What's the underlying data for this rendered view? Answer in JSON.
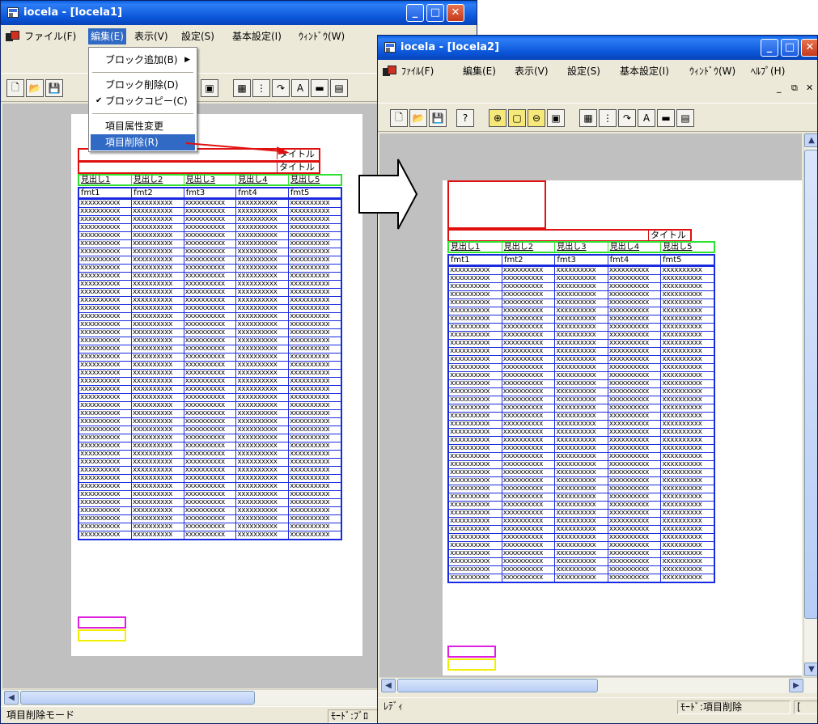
{
  "window1": {
    "title": "iocela - [Iocela1]",
    "menu": [
      "ファイル(F)",
      "編集(E)",
      "表示(V)",
      "設定(S)",
      "基本設定(I)",
      "ｳｨﾝﾄﾞｳ(W)"
    ],
    "dropdown": {
      "items": [
        "ブロック追加(B)",
        "ブロック削除(D)",
        "ブロックコピー(C)",
        "項目属性変更",
        "項目削除(R)"
      ],
      "checked": "ブロックコピー(C)",
      "highlighted": "項目削除(R)"
    },
    "titles": [
      "タイトル",
      "タイトル"
    ],
    "status_left": "項目削除モード",
    "status_right": "ﾓｰﾄﾞ:ﾌﾞﾛ"
  },
  "window2": {
    "title": "iocela - [Iocela2]",
    "menu": [
      "ﾌｧｲﾙ(F)",
      "編集(E)",
      "表示(V)",
      "設定(S)",
      "基本設定(I)",
      "ｳｨﾝﾄﾞｳ(W)",
      "ﾍﾙﾌﾟ(H)"
    ],
    "titles": [
      "タイトル"
    ],
    "status_left": "ﾚﾃﾞｨ",
    "status_right": "ﾓｰﾄﾞ:項目削除"
  },
  "table": {
    "headers": [
      "見出し1",
      "見出し2",
      "見出し3",
      "見出し4",
      "見出し5"
    ],
    "formats": [
      "fmt1",
      "fmt2",
      "fmt3",
      "fmt4",
      "fmt5"
    ],
    "cell": "xxxxxxxxxx"
  },
  "colors": {
    "title_block": "#e01010",
    "header_block": "#30e030",
    "data_block": "#1a2ae0",
    "footer_block_1": "#e020e0",
    "footer_block_2": "#f0f000"
  },
  "icons": [
    "new-icon",
    "open-icon",
    "save-icon",
    "help-icon",
    "zoom-in-icon",
    "page-icon",
    "zoom-out-icon",
    "fit-icon",
    "grid-icon",
    "columns-icon",
    "rotate-icon",
    "text-icon",
    "window-icon",
    "form-icon"
  ]
}
